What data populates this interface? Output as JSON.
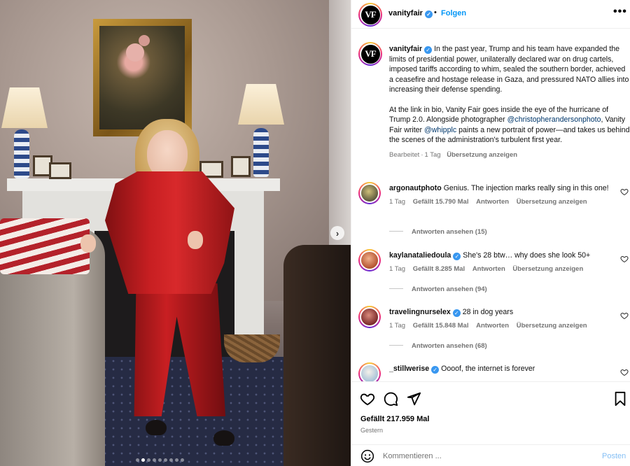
{
  "header": {
    "username": "vanityfair",
    "separator": "•",
    "follow_label": "Folgen",
    "more_label": "•••",
    "avatar_text": "VF"
  },
  "caption": {
    "username": "vanityfair",
    "paragraph1": "In the past year, Trump and his team have expanded the limits of presidential power, unilaterally declared war on drug cartels, imposed tariffs according to whim, sealed the southern border, achieved a ceasefire and hostage release in Gaza, and pressured NATO allies into increasing their defense spending.",
    "paragraph2_start": "At the link in bio, Vanity Fair goes inside the eye of the hurricane of Trump 2.0. Alongside photographer ",
    "mention1": "@christopherandersonphoto",
    "paragraph2_mid": ", Vanity Fair writer ",
    "mention2": "@whipplc",
    "paragraph2_end": " paints a new portrait of power—and takes us behind the scenes of the administration's turbulent first year.",
    "edited": "Bearbeitet",
    "dot": "·",
    "age": "1 Tag",
    "translate": "Übersetzung anzeigen"
  },
  "comments": [
    {
      "username": "argonautphoto",
      "text": "Genius. The injection marks really sing in this one!",
      "age": "1 Tag",
      "likes": "Gefällt 15.790 Mal",
      "reply": "Antworten",
      "translate": "Übersetzung anzeigen",
      "replies": "Antworten ansehen (15)",
      "verified": false
    },
    {
      "username": "kaylanataliedoula",
      "text": "She's 28 btw… why does she look 50+",
      "age": "1 Tag",
      "likes": "Gefällt 8.285 Mal",
      "reply": "Antworten",
      "translate": "Übersetzung anzeigen",
      "replies": "Antworten ansehen (94)",
      "verified": true
    },
    {
      "username": "travelingnurselex",
      "text": "28 in dog years",
      "age": "1 Tag",
      "likes": "Gefällt 15.848 Mal",
      "reply": "Antworten",
      "translate": "Übersetzung anzeigen",
      "replies": "Antworten ansehen (68)",
      "verified": true
    },
    {
      "username": "_stillwerise",
      "text": "Oooof, the internet is forever",
      "verified": true
    }
  ],
  "actions": {
    "likes": "Gefällt 217.959 Mal",
    "date": "Gestern"
  },
  "composer": {
    "placeholder": "Kommentieren ...",
    "post_label": "Posten"
  },
  "carousel": {
    "next_label": "›",
    "slide_count": 9,
    "active_index": 1
  },
  "colors": {
    "accent": "#0095f6",
    "verified": "#3897f0",
    "muted": "#737373",
    "post_disabled": "#85bff5"
  }
}
